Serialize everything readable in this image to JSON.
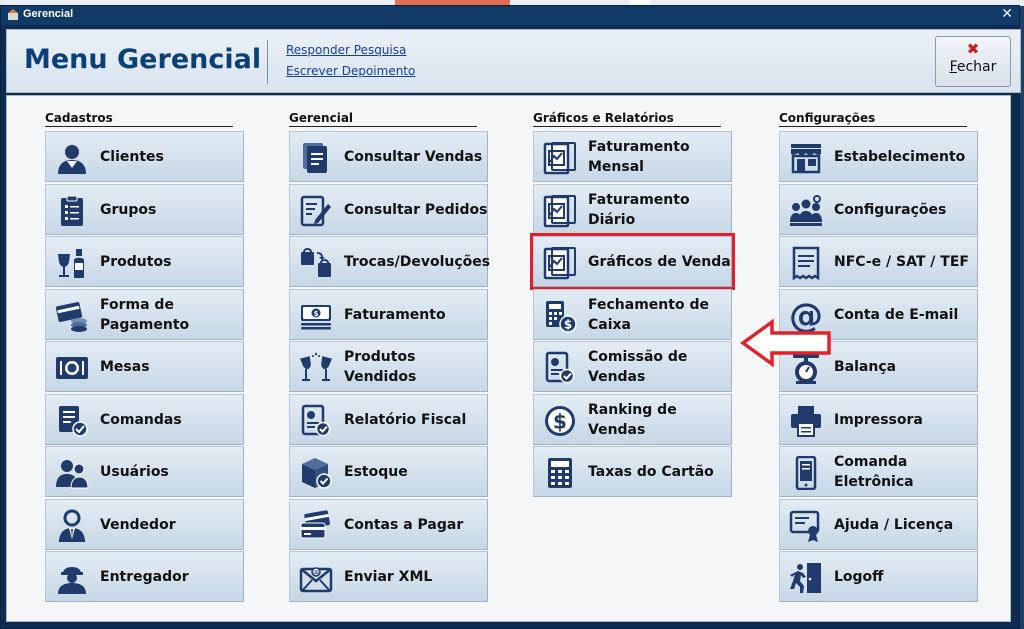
{
  "window": {
    "title": "Gerencial",
    "close_glyph": "✕"
  },
  "header": {
    "title": "Menu Gerencial",
    "links": [
      "Responder Pesquisa",
      "Escrever Depoimento"
    ],
    "close_button": {
      "label": "Fechar",
      "icon": "close-red-x-icon"
    }
  },
  "columns": [
    {
      "title": "Cadastros",
      "items": [
        {
          "label": "Clientes",
          "icon": "client-icon"
        },
        {
          "label": "Grupos",
          "icon": "clipboard-list-icon"
        },
        {
          "label": "Produtos",
          "icon": "wine-bottle-icon"
        },
        {
          "label": "Forma de Pagamento",
          "icon": "card-coins-icon"
        },
        {
          "label": "Mesas",
          "icon": "table-plate-icon"
        },
        {
          "label": "Comandas",
          "icon": "checklist-icon"
        },
        {
          "label": "Usuários",
          "icon": "users-icon"
        },
        {
          "label": "Vendedor",
          "icon": "salesman-icon"
        },
        {
          "label": "Entregador",
          "icon": "delivery-person-icon"
        }
      ]
    },
    {
      "title": "Gerencial",
      "items": [
        {
          "label": "Consultar Vendas",
          "icon": "document-icon"
        },
        {
          "label": "Consultar Pedidos",
          "icon": "edit-document-icon"
        },
        {
          "label": "Trocas/Devoluções",
          "icon": "shopping-bags-swap-icon"
        },
        {
          "label": "Faturamento",
          "icon": "money-stack-icon"
        },
        {
          "label": "Produtos Vendidos",
          "icon": "wine-glasses-icon"
        },
        {
          "label": "Relatório Fiscal",
          "icon": "fiscal-report-icon"
        },
        {
          "label": "Estoque",
          "icon": "stock-box-icon"
        },
        {
          "label": "Contas a Pagar",
          "icon": "cards-pay-icon"
        },
        {
          "label": "Enviar XML",
          "icon": "envelope-icon"
        }
      ]
    },
    {
      "title": "Gráficos e Relatórios",
      "items": [
        {
          "label": "Faturamento Mensal",
          "icon": "chart-doc-icon"
        },
        {
          "label": "Faturamento Diário",
          "icon": "chart-doc-icon"
        },
        {
          "label": "Gráficos de Venda",
          "icon": "chart-doc-icon",
          "highlighted": true
        },
        {
          "label": "Fechamento de Caixa",
          "icon": "calculator-money-icon"
        },
        {
          "label": "Comissão de Vendas",
          "icon": "commission-doc-icon"
        },
        {
          "label": "Ranking de Vendas",
          "icon": "dollar-circle-icon"
        },
        {
          "label": "Taxas do Cartão",
          "icon": "calculator-icon"
        }
      ]
    },
    {
      "title": "Configurações",
      "items": [
        {
          "label": "Estabelecimento",
          "icon": "storefront-icon"
        },
        {
          "label": "Configurações",
          "icon": "people-settings-icon"
        },
        {
          "label": "NFC-e / SAT / TEF",
          "icon": "receipt-icon"
        },
        {
          "label": "Conta de E-mail",
          "icon": "at-sign-icon"
        },
        {
          "label": "Balança",
          "icon": "scale-icon"
        },
        {
          "label": "Impressora",
          "icon": "printer-icon"
        },
        {
          "label": "Comanda Eletrônica",
          "icon": "mobile-device-icon"
        },
        {
          "label": "Ajuda / Licença",
          "icon": "help-license-icon"
        },
        {
          "label": "Logoff",
          "icon": "logoff-door-icon"
        }
      ]
    }
  ],
  "annotation": {
    "arrow_color": "#e0202a"
  },
  "colors": {
    "accent": "#0b3f78",
    "icon": "#1f3a6b",
    "title_bar": "#123a66",
    "highlight": "#e0202a"
  }
}
